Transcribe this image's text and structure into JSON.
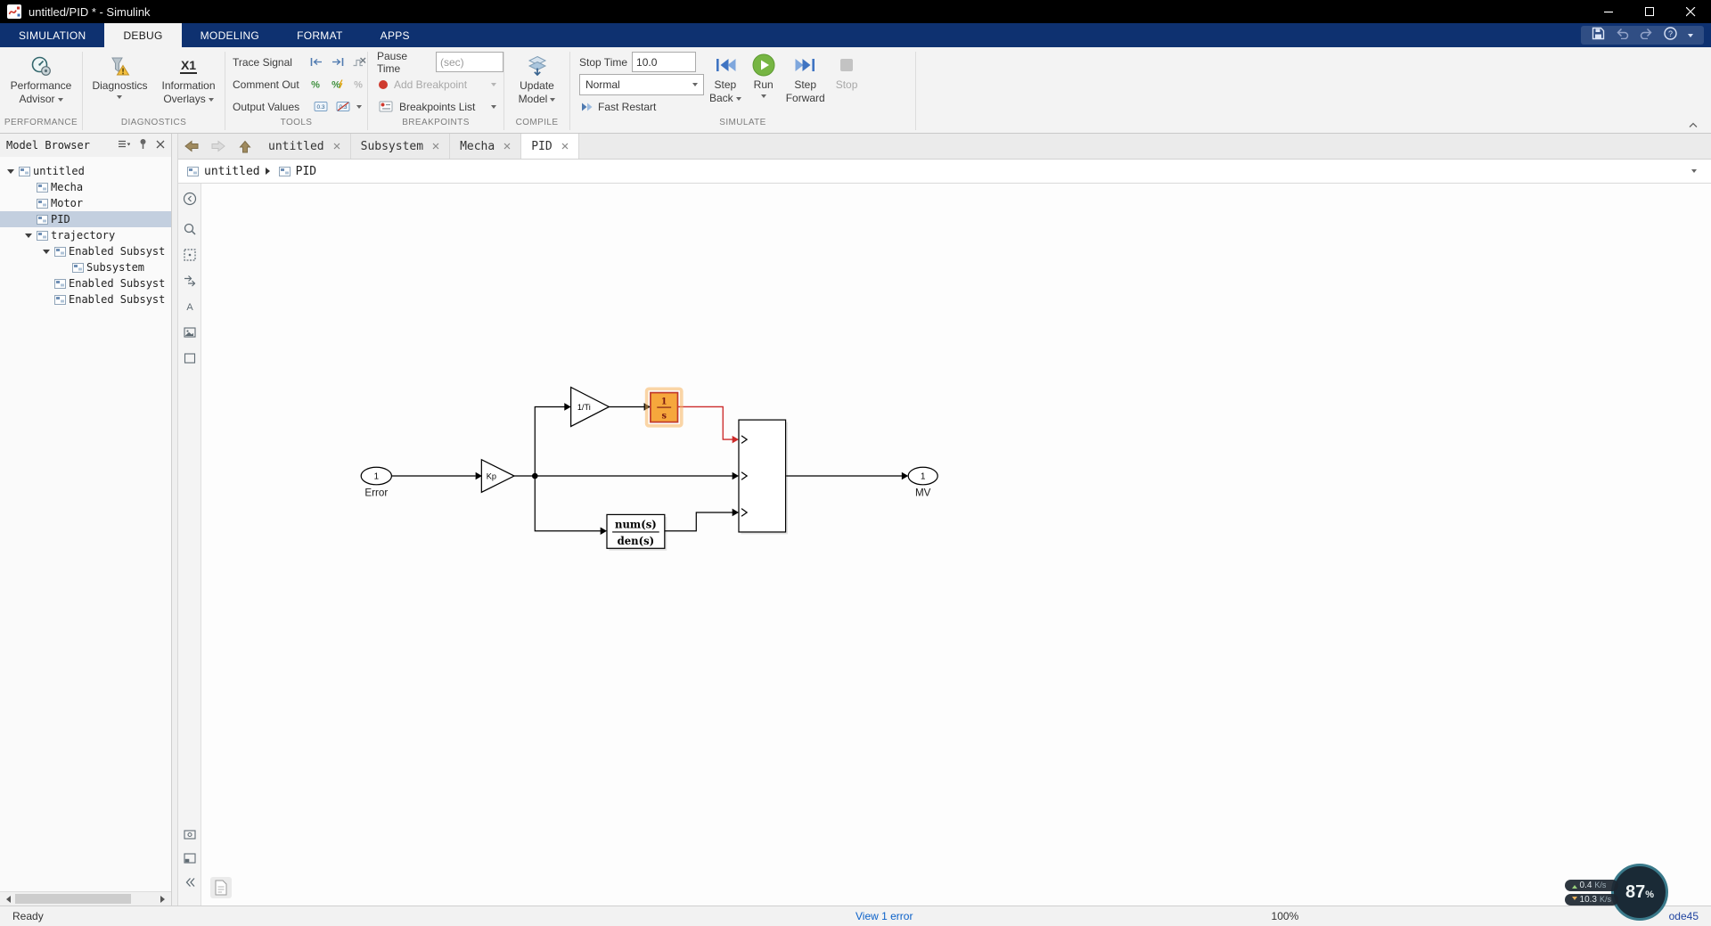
{
  "window": {
    "title": "untitled/PID * - Simulink"
  },
  "ribbon": {
    "tabs": [
      {
        "label": "SIMULATION"
      },
      {
        "label": "DEBUG"
      },
      {
        "label": "MODELING"
      },
      {
        "label": "FORMAT"
      },
      {
        "label": "APPS"
      }
    ],
    "performance": {
      "label": "PERFORMANCE",
      "advisor_line1": "Performance",
      "advisor_line2": "Advisor"
    },
    "diagnostics": {
      "label": "DIAGNOSTICS",
      "diagnostics": "Diagnostics",
      "overlays_line1": "Information",
      "overlays_line2": "Overlays",
      "overlays_icon": "X1"
    },
    "tools": {
      "label": "TOOLS",
      "trace_signal": "Trace Signal",
      "comment_out": "Comment Out",
      "output_values": "Output Values",
      "output_badge": "0.3"
    },
    "breakpoints": {
      "label": "BREAKPOINTS",
      "pause_time": "Pause Time",
      "pause_placeholder": "(sec)",
      "add_breakpoint": "Add Breakpoint",
      "breakpoints_list": "Breakpoints List"
    },
    "compile": {
      "label": "COMPILE",
      "update_line1": "Update",
      "update_line2": "Model"
    },
    "simulate": {
      "label": "SIMULATE",
      "stop_time": "Stop Time",
      "stop_time_value": "10.0",
      "mode": "Normal",
      "fast_restart": "Fast Restart",
      "step_back_line1": "Step",
      "step_back_line2": "Back",
      "run": "Run",
      "step_fwd_line1": "Step",
      "step_fwd_line2": "Forward",
      "stop": "Stop"
    }
  },
  "model_browser": {
    "title": "Model Browser",
    "tree": [
      {
        "label": "untitled"
      },
      {
        "label": "Mecha"
      },
      {
        "label": "Motor"
      },
      {
        "label": "PID"
      },
      {
        "label": "trajectory"
      },
      {
        "label": "Enabled Subsyst"
      },
      {
        "label": "Subsystem"
      },
      {
        "label": "Enabled Subsyst"
      },
      {
        "label": "Enabled Subsyst"
      }
    ]
  },
  "editor": {
    "tabs": [
      {
        "label": "untitled"
      },
      {
        "label": "Subsystem"
      },
      {
        "label": "Mecha"
      },
      {
        "label": "PID"
      }
    ],
    "breadcrumb": [
      {
        "label": "untitled"
      },
      {
        "label": "PID"
      }
    ]
  },
  "diagram": {
    "inport": {
      "number": "1",
      "name": "Error"
    },
    "gain_kp": {
      "label": "Kp"
    },
    "gain_ti": {
      "label": "1/Ti"
    },
    "integrator": {
      "numerator": "1",
      "denominator": "s"
    },
    "transfer_fcn": {
      "numerator": "num(s)",
      "denominator": "den(s)"
    },
    "outport": {
      "number": "1",
      "name": "MV"
    }
  },
  "statusbar": {
    "status": "Ready",
    "error_link": "View 1 error",
    "zoom": "100%",
    "solver": "ode45"
  },
  "net_widget": {
    "upload": "0.4",
    "download": "10.3",
    "unit": "K/s",
    "percent": "87",
    "percent_symbol": "%"
  }
}
